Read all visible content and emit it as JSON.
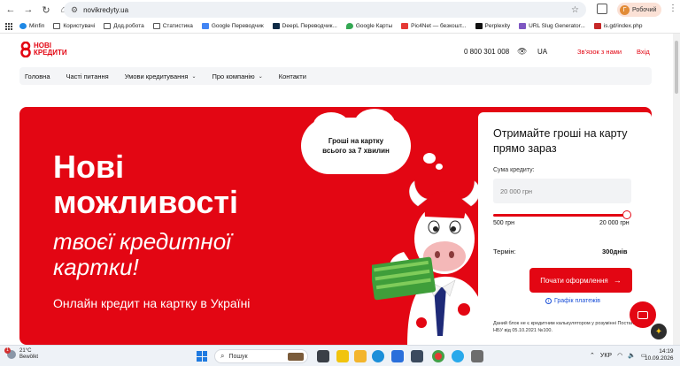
{
  "browser": {
    "url": "novikredyty.ua",
    "profile_name": "Робочий",
    "profile_initial": "Г",
    "bookmarks": [
      {
        "label": "Minfin",
        "icon": "minfin-icon",
        "color": "#1e88e5"
      },
      {
        "label": "Користувачі",
        "icon": "folder-icon",
        "color": ""
      },
      {
        "label": "Дод.робота",
        "icon": "folder-icon",
        "color": ""
      },
      {
        "label": "Статистика",
        "icon": "folder-icon",
        "color": ""
      },
      {
        "label": "Google Переводчик",
        "icon": "google-translate-icon",
        "color": "#4285f4"
      },
      {
        "label": "DeepL Переводчик...",
        "icon": "deepl-icon",
        "color": "#0f2b46"
      },
      {
        "label": "Google Карты",
        "icon": "google-maps-icon",
        "color": "#34a853"
      },
      {
        "label": "Pic4Net — безкошт...",
        "icon": "pic4net-icon",
        "color": "#e53935"
      },
      {
        "label": "Perplexity",
        "icon": "perplexity-icon",
        "color": "#111111"
      },
      {
        "label": "URL Slug Generator...",
        "icon": "url-slug-icon",
        "color": "#7e57c2"
      },
      {
        "label": "is.gd/index.php",
        "icon": "isgd-icon",
        "color": "#c62828"
      }
    ]
  },
  "header": {
    "logo_line1": "НОВІ",
    "logo_line2": "КРЕДИТИ",
    "phone": "0 800 301 008",
    "lang": "UA",
    "contact": "Зв'язок з нами",
    "login": "Вхід"
  },
  "nav": [
    {
      "label": "Головна",
      "dropdown": false
    },
    {
      "label": "Часті питання",
      "dropdown": false
    },
    {
      "label": "Умови кредитування",
      "dropdown": true
    },
    {
      "label": "Про компанію",
      "dropdown": true
    },
    {
      "label": "Контакти",
      "dropdown": false
    }
  ],
  "hero": {
    "title_line1": "Нові",
    "title_line2": "можливості",
    "title_line3": "твоєї кредитної",
    "title_line4": "картки!",
    "subtitle": "Онлайн кредит на картку в Україні",
    "cloud_line1": "Гроші на картку",
    "cloud_line2": "всього за 7 хвилин"
  },
  "form": {
    "title": "Отримайте гроші на карту прямо зараз",
    "sum_label": "Сума кредиту:",
    "sum_placeholder": "20 000 грн",
    "slider_level": 1.0,
    "min_label": "500 грн",
    "max_label": "20 000 грн",
    "term_label": "Термін:",
    "term_value": "300днів",
    "cta_label": "Почати оформлення",
    "schedule_link": "Графік платежів",
    "note": "Даний блок не є кредитним калькулятором у розумінні Постанови НБУ від 05.10.2021 №100."
  },
  "colors": {
    "brand_red": "#e30613",
    "link_blue": "#1a4fd8"
  },
  "taskbar": {
    "temp": "21°C",
    "weather": "Bewölkt",
    "weather_badge": "1",
    "search_placeholder": "Пошук",
    "lang": "УКР",
    "time": "14:19",
    "date": "10.09.2026"
  }
}
